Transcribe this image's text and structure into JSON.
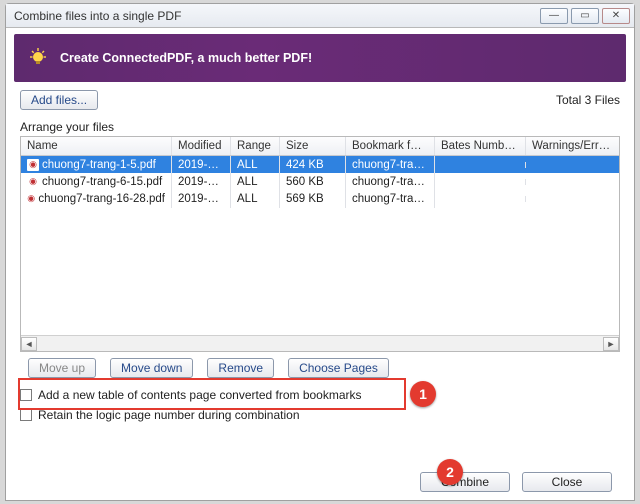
{
  "window": {
    "title": "Combine files into a single PDF"
  },
  "banner": {
    "text": "Create ConnectedPDF, a much better PDF!"
  },
  "toolbar": {
    "add_files": "Add files...",
    "total": "Total 3 Files"
  },
  "section": {
    "arrange": "Arrange your files"
  },
  "columns": {
    "name": "Name",
    "modified": "Modified",
    "range": "Range",
    "size": "Size",
    "bookmark": "Bookmark for ...",
    "bates": "Bates Numbe...",
    "warnings": "Warnings/Errors"
  },
  "files": [
    {
      "name": "chuong7-trang-1-5.pdf",
      "modified": "2019-06...",
      "range": "ALL",
      "size": "424 KB",
      "bookmark": "chuong7-tran...",
      "selected": true
    },
    {
      "name": "chuong7-trang-6-15.pdf",
      "modified": "2019-06...",
      "range": "ALL",
      "size": "560 KB",
      "bookmark": "chuong7-tran...",
      "selected": false
    },
    {
      "name": "chuong7-trang-16-28.pdf",
      "modified": "2019-06...",
      "range": "ALL",
      "size": "569 KB",
      "bookmark": "chuong7-tran...",
      "selected": false
    }
  ],
  "actions": {
    "move_up": "Move up",
    "move_down": "Move down",
    "remove": "Remove",
    "choose_pages": "Choose Pages"
  },
  "checks": {
    "toc": "Add a new table of contents page converted from bookmarks",
    "logic": "Retain the logic page number during combination"
  },
  "footer": {
    "combine": "Combine",
    "close": "Close"
  },
  "callouts": {
    "one": "1",
    "two": "2"
  }
}
